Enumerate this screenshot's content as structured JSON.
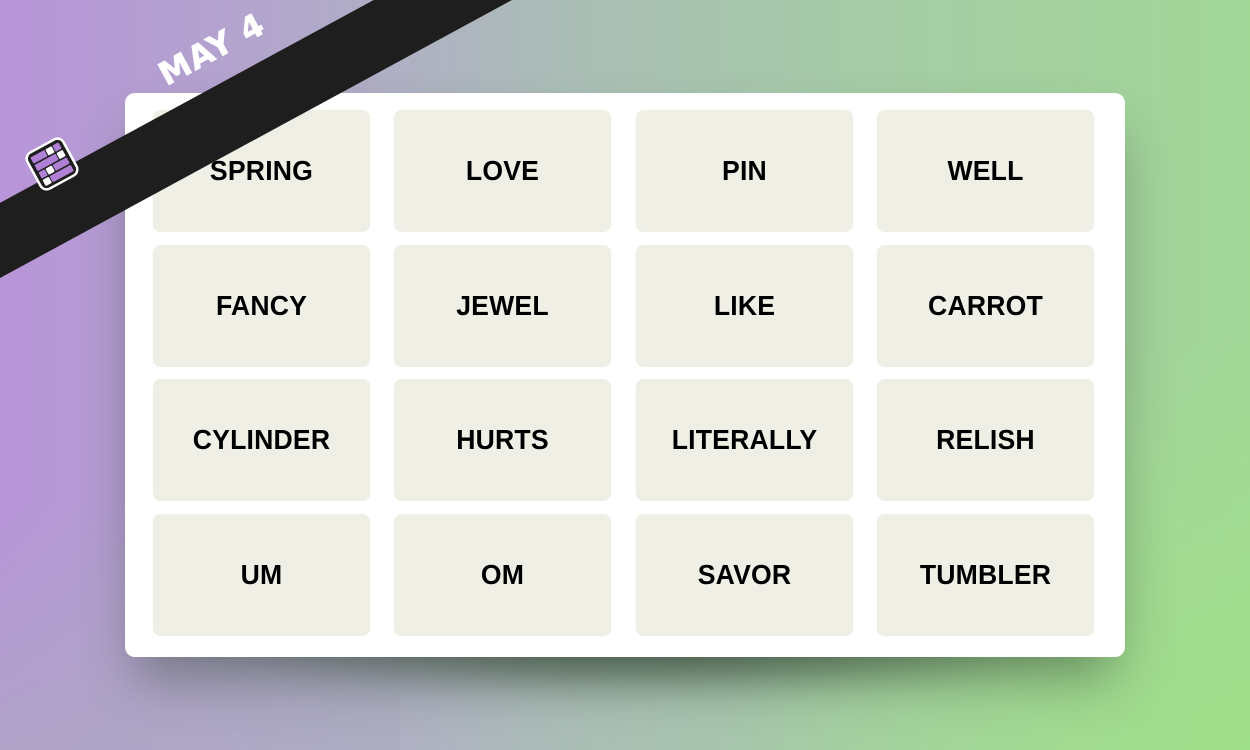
{
  "banner": {
    "date": "MAY 4",
    "icon": "connections-grid-icon",
    "background": "#1e1e1e",
    "text_color": "#ffffff"
  },
  "colors": {
    "background_left": "#b796d8",
    "background_right": "#a0df8a",
    "panel": "#ffffff",
    "tile": "#efefe6",
    "tile_text": "#000000",
    "logo_purple": "#b07fd6"
  },
  "board": {
    "rows": [
      [
        "SPRING",
        "LOVE",
        "PIN",
        "WELL"
      ],
      [
        "FANCY",
        "JEWEL",
        "LIKE",
        "CARROT"
      ],
      [
        "CYLINDER",
        "HURTS",
        "LITERALLY",
        "RELISH"
      ],
      [
        "UM",
        "OM",
        "SAVOR",
        "TUMBLER"
      ]
    ]
  }
}
